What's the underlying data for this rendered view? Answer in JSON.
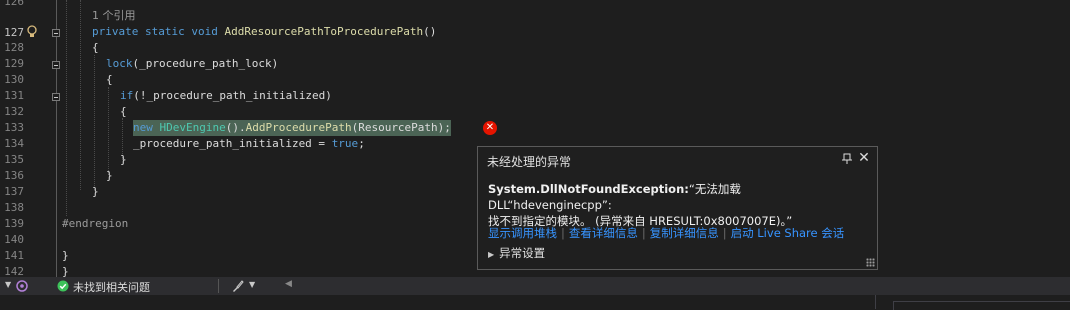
{
  "editor": {
    "line_numbers": [
      "126",
      "127",
      "128",
      "129",
      "130",
      "131",
      "132",
      "133",
      "134",
      "135",
      "136",
      "137",
      "138",
      "139",
      "140",
      "141",
      "142"
    ],
    "reference_hint": "1 个引用",
    "code": {
      "l127_kw": "private static void ",
      "l127_fn": "AddResourcePathToProcedurePath",
      "l127_rest": "()",
      "l128": "{",
      "l129_kw": "lock",
      "l129_rest": "(_procedure_path_lock)",
      "l130": "{",
      "l131_kw": "if",
      "l131_rest": "(!_procedure_path_initialized)",
      "l132": "{",
      "l133_kw": "new ",
      "l133_cl": "HDevEngine",
      "l133_mid": "().",
      "l133_fn": "AddProcedurePath",
      "l133_rest": "(ResourcePath);",
      "l134_id": "_procedure_path_initialized = ",
      "l134_kw": "true",
      "l134_rest": ";",
      "l135": "}",
      "l136": "}",
      "l137": "}",
      "l139": "#endregion",
      "l141": "}",
      "l142": "}"
    }
  },
  "exception_popup": {
    "title": "未经处理的异常",
    "exception_type": "System.DllNotFoundException:",
    "message_line1": "“无法加载 DLL“hdevenginecpp”:",
    "message_line2": "找不到指定的模块。 (异常来自 HRESULT:0x8007007E)。”",
    "links": [
      "显示调用堆栈",
      "查看详细信息",
      "复制详细信息",
      "启动 Live Share 会话"
    ],
    "settings_label": "异常设置",
    "pin_icon": "pin-icon",
    "close_icon": "close-icon"
  },
  "status_bar": {
    "issues_text": "未找到相关问题",
    "ok_color": "#3dc25a"
  },
  "colors": {
    "keyword": "#569cd6",
    "function": "#dcdcaa",
    "class": "#4ec9b0",
    "highlight": "#4b6455",
    "error": "#e51400",
    "link": "#3794ff"
  }
}
